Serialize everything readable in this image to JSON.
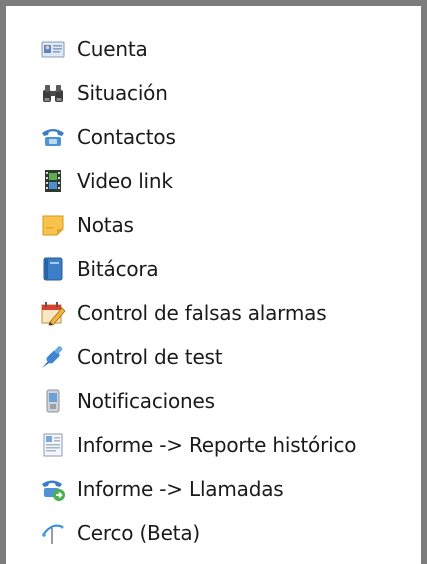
{
  "menu": {
    "items": [
      {
        "label": "Cuenta",
        "icon": "account-card-icon"
      },
      {
        "label": "Situación",
        "icon": "binoculars-icon"
      },
      {
        "label": "Contactos",
        "icon": "telephone-icon"
      },
      {
        "label": "Video link",
        "icon": "film-strip-icon"
      },
      {
        "label": "Notas",
        "icon": "sticky-note-icon"
      },
      {
        "label": "Bitácora",
        "icon": "logbook-icon"
      },
      {
        "label": "Control de falsas alarmas",
        "icon": "calendar-pencil-icon"
      },
      {
        "label": "Control de test",
        "icon": "test-probe-icon"
      },
      {
        "label": "Notificaciones",
        "icon": "mobile-phone-icon"
      },
      {
        "label": "Informe -> Reporte histórico",
        "icon": "report-document-icon"
      },
      {
        "label": "Informe -> Llamadas",
        "icon": "call-report-icon"
      },
      {
        "label": "Cerco (Beta)",
        "icon": "fence-icon"
      }
    ]
  }
}
